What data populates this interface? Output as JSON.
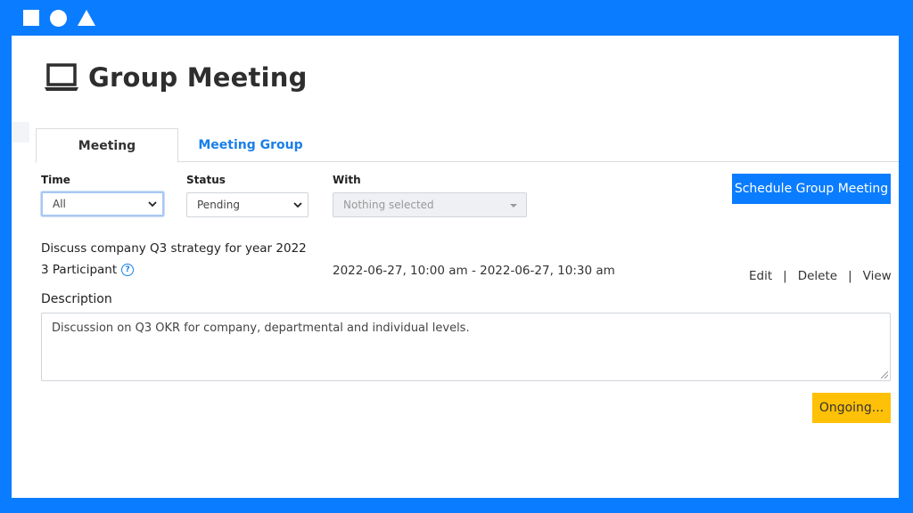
{
  "page": {
    "title": "Group Meeting",
    "icon": "laptop-icon"
  },
  "tabs": [
    {
      "label": "Meeting",
      "active": true
    },
    {
      "label": "Meeting Group",
      "active": false
    }
  ],
  "filters": {
    "time": {
      "label": "Time",
      "value": "All"
    },
    "status": {
      "label": "Status",
      "value": "Pending"
    },
    "with": {
      "label": "With",
      "placeholder": "Nothing selected"
    }
  },
  "actions_bar": {
    "schedule_label": "Schedule Group Meeting"
  },
  "meeting": {
    "title": "Discuss company Q3 strategy for year 2022",
    "participants": "3 Participant",
    "time_range": "2022-06-27, 10:00 am - 2022-06-27, 10:30 am",
    "edit_label": "Edit",
    "delete_label": "Delete",
    "view_label": "View",
    "separator": "|",
    "description_label": "Description",
    "description": "Discussion on Q3 OKR for company, departmental and individual levels.",
    "ongoing_label": "Ongoing..."
  },
  "colors": {
    "frame": "#0a7cff",
    "primary_button": "#0a7cff",
    "link": "#1a7fe8",
    "ongoing_button": "#ffc107"
  }
}
